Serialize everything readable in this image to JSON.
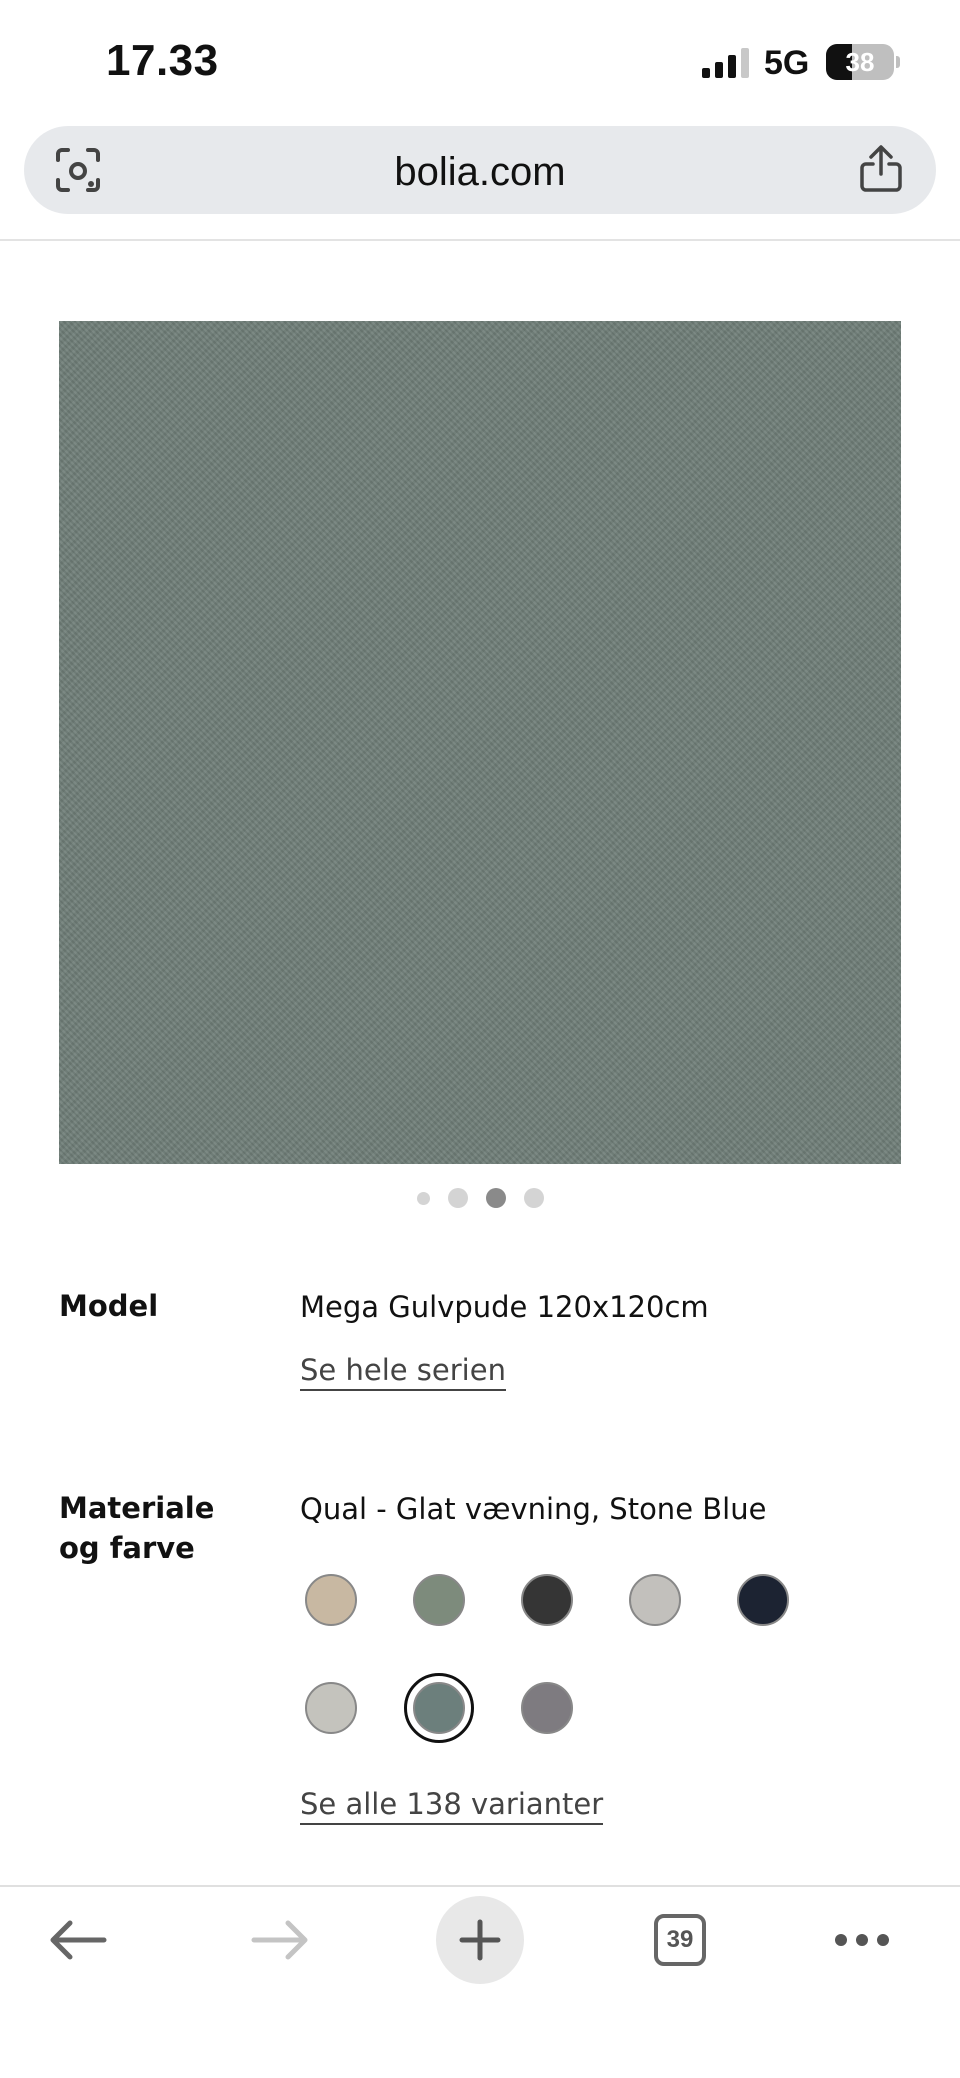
{
  "status_bar": {
    "time": "17.33",
    "network": "5G",
    "battery": "38",
    "battery_level": 0.38
  },
  "browser": {
    "url": "bolia.com"
  },
  "product": {
    "image_color": "#6f7e78",
    "carousel": {
      "total": 4,
      "active_index": 2
    },
    "model": {
      "label": "Model",
      "value": "Mega Gulvpude 120x120cm",
      "link": "Se hele serien"
    },
    "material": {
      "label_line1": "Materiale",
      "label_line2": "og farve",
      "value": "Qual - Glat vævning, Stone Blue",
      "link": "Se alle 138 varianter",
      "swatches": [
        {
          "color": "#c8b8a2",
          "selected": false
        },
        {
          "color": "#7d8b7c",
          "selected": false
        },
        {
          "color": "#353535",
          "selected": false
        },
        {
          "color": "#c2c0bc",
          "selected": false
        },
        {
          "color": "#1c2332",
          "selected": false
        },
        {
          "color": "#c4c3bd",
          "selected": false
        },
        {
          "color": "#6c7f7c",
          "selected": true
        },
        {
          "color": "#7e7b80",
          "selected": false
        }
      ]
    }
  },
  "toolbar": {
    "tab_count": "39"
  }
}
